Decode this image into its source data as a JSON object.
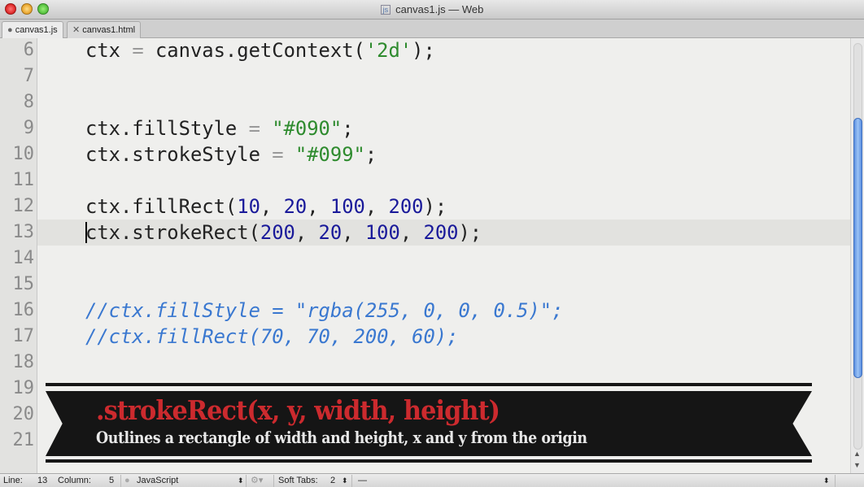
{
  "window": {
    "title": "canvas1.js — Web",
    "file_badge": "js"
  },
  "tabs": [
    {
      "label": "canvas1.js",
      "icon": "dot-icon",
      "active": true
    },
    {
      "label": "canvas1.html",
      "icon": "close-icon",
      "active": false
    }
  ],
  "lines": [
    {
      "n": "6",
      "tokens": [
        [
          "ctx ",
          ""
        ],
        [
          "=",
          "op"
        ],
        [
          " canvas.getContext(",
          ""
        ],
        [
          "'2d'",
          "str"
        ],
        [
          ");",
          ""
        ]
      ]
    },
    {
      "n": "7",
      "tokens": []
    },
    {
      "n": "8",
      "tokens": []
    },
    {
      "n": "9",
      "tokens": [
        [
          "ctx.fillStyle ",
          ""
        ],
        [
          "=",
          "op"
        ],
        [
          " ",
          ""
        ],
        [
          "\"#090\"",
          "str"
        ],
        [
          ";",
          ""
        ]
      ]
    },
    {
      "n": "10",
      "tokens": [
        [
          "ctx.strokeStyle ",
          ""
        ],
        [
          "=",
          "op"
        ],
        [
          " ",
          ""
        ],
        [
          "\"#099\"",
          "str"
        ],
        [
          ";",
          ""
        ]
      ]
    },
    {
      "n": "11",
      "tokens": []
    },
    {
      "n": "12",
      "tokens": [
        [
          "ctx.fillRect(",
          ""
        ],
        [
          "10",
          "num"
        ],
        [
          ", ",
          ""
        ],
        [
          "20",
          "num"
        ],
        [
          ", ",
          ""
        ],
        [
          "100",
          "num"
        ],
        [
          ", ",
          ""
        ],
        [
          "200",
          "num"
        ],
        [
          ");",
          ""
        ]
      ]
    },
    {
      "n": "13",
      "current": true,
      "tokens": [
        [
          "ctx.strokeRect(",
          ""
        ],
        [
          "200",
          "num"
        ],
        [
          ", ",
          ""
        ],
        [
          "20",
          "num"
        ],
        [
          ", ",
          ""
        ],
        [
          "100",
          "num"
        ],
        [
          ", ",
          ""
        ],
        [
          "200",
          "num"
        ],
        [
          ");",
          ""
        ]
      ]
    },
    {
      "n": "14",
      "tokens": []
    },
    {
      "n": "15",
      "tokens": []
    },
    {
      "n": "16",
      "tokens": [
        [
          "//ctx.fillStyle = \"rgba(255, 0, 0, 0.5)\";",
          "com"
        ]
      ]
    },
    {
      "n": "17",
      "tokens": [
        [
          "//ctx.fillRect(70, 70, 200, 60);",
          "com"
        ]
      ]
    },
    {
      "n": "18",
      "tokens": []
    },
    {
      "n": "19",
      "tokens": []
    },
    {
      "n": "20",
      "tokens": []
    },
    {
      "n": "21",
      "tokens": []
    }
  ],
  "banner": {
    "title": ".strokeRect(x, y, width, height)",
    "subtitle": "Outlines a rectangle of width and height, x and y from the origin",
    "title_color": "#cc2a2e"
  },
  "status": {
    "line_label": "Line:",
    "line": "13",
    "column_label": "Column:",
    "column": "5",
    "language": "JavaScript",
    "soft_tabs_label": "Soft Tabs:",
    "soft_tabs": "2",
    "symbol": "—"
  },
  "scrollbar": {
    "position_fraction": 0.2,
    "visible_fraction": 0.64
  }
}
